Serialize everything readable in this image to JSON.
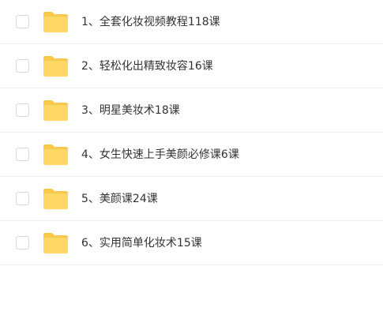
{
  "colors": {
    "folder_body": "#FFD766",
    "folder_tab": "#F9C84A",
    "text": "#333333",
    "divider": "#F0F0F0",
    "checkbox_border": "#D9D9D9"
  },
  "files": [
    {
      "name": "1、全套化妆视频教程118课",
      "icon": "folder-icon",
      "checked": false
    },
    {
      "name": "2、轻松化出精致妆容16课",
      "icon": "folder-icon",
      "checked": false
    },
    {
      "name": "3、明星美妆术18课",
      "icon": "folder-icon",
      "checked": false
    },
    {
      "name": "4、女生快速上手美颜必修课6课",
      "icon": "folder-icon",
      "checked": false
    },
    {
      "name": "5、美颜课24课",
      "icon": "folder-icon",
      "checked": false
    },
    {
      "name": "6、实用简单化妆术15课",
      "icon": "folder-icon",
      "checked": false
    }
  ]
}
